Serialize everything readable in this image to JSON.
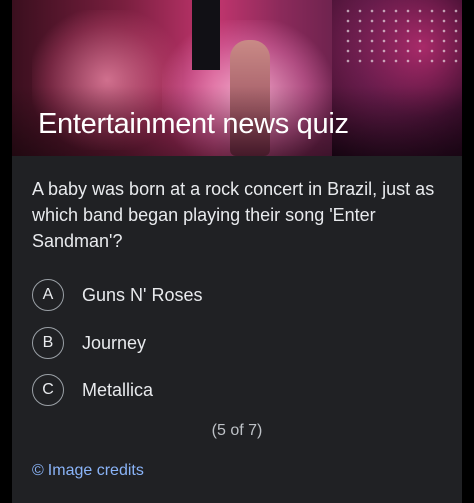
{
  "hero": {
    "title": "Entertainment news quiz"
  },
  "quiz": {
    "question": "A baby was born at a rock concert in Brazil, just as which band began playing their song 'Enter Sandman'?",
    "options": [
      {
        "letter": "A",
        "text": "Guns N' Roses"
      },
      {
        "letter": "B",
        "text": "Journey"
      },
      {
        "letter": "C",
        "text": "Metallica"
      }
    ],
    "progress": "(5 of 7)"
  },
  "footer": {
    "credits_icon": "©",
    "credits_label": "Image credits"
  },
  "colors": {
    "card_background": "#202124",
    "text_primary": "#e8eaed",
    "link": "#8ab4f8"
  }
}
